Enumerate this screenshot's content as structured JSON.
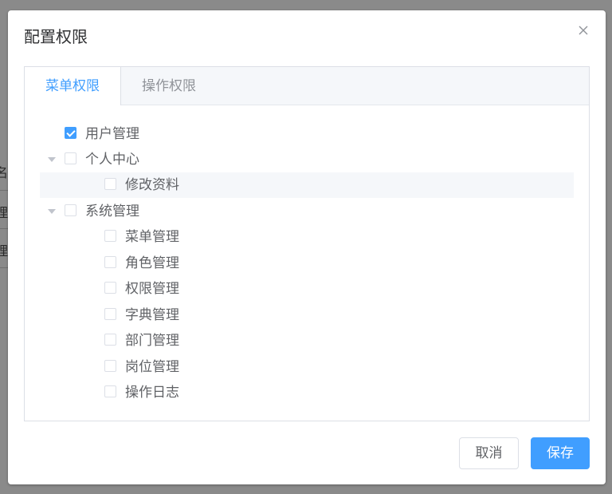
{
  "background": {
    "fragments": [
      "名",
      "理",
      "理"
    ]
  },
  "dialog": {
    "title": "配置权限",
    "close_icon": "close-icon",
    "tabs": [
      {
        "label": "菜单权限",
        "active": true
      },
      {
        "label": "操作权限",
        "active": false
      }
    ],
    "tree": [
      {
        "label": "用户管理",
        "checked": true,
        "level": 0,
        "expandable": false
      },
      {
        "label": "个人中心",
        "checked": false,
        "level": 0,
        "expandable": true
      },
      {
        "label": "修改资料",
        "checked": false,
        "level": 1,
        "expandable": false,
        "highlighted": true
      },
      {
        "label": "系统管理",
        "checked": false,
        "level": 0,
        "expandable": true
      },
      {
        "label": "菜单管理",
        "checked": false,
        "level": 1,
        "expandable": false
      },
      {
        "label": "角色管理",
        "checked": false,
        "level": 1,
        "expandable": false
      },
      {
        "label": "权限管理",
        "checked": false,
        "level": 1,
        "expandable": false
      },
      {
        "label": "字典管理",
        "checked": false,
        "level": 1,
        "expandable": false
      },
      {
        "label": "部门管理",
        "checked": false,
        "level": 1,
        "expandable": false
      },
      {
        "label": "岗位管理",
        "checked": false,
        "level": 1,
        "expandable": false
      },
      {
        "label": "操作日志",
        "checked": false,
        "level": 1,
        "expandable": false
      }
    ],
    "footer": {
      "cancel_label": "取消",
      "save_label": "保存"
    }
  },
  "colors": {
    "accent": "#409eff",
    "overlay": "#7f7f7f"
  }
}
